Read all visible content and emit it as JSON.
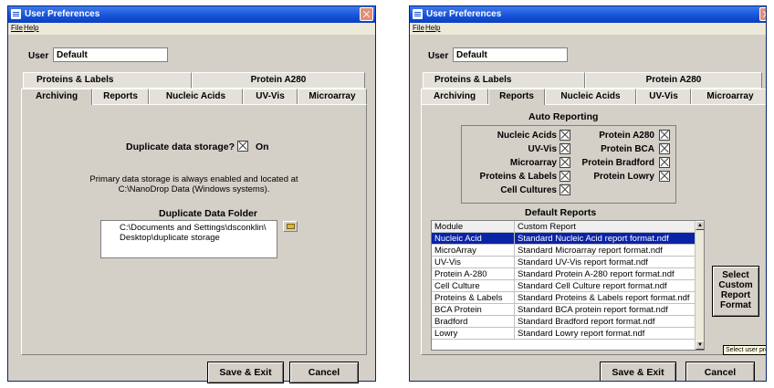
{
  "window_left": {
    "title": "User Preferences",
    "menu": {
      "file": "File",
      "help": "Help"
    },
    "user_label": "User",
    "user_value": "Default",
    "tabs_row1": [
      "Proteins & Labels",
      "Protein A280"
    ],
    "tabs_row2": [
      "Archiving",
      "Reports",
      "Nucleic Acids",
      "UV-Vis",
      "Microarray"
    ],
    "selected_tab": "Archiving",
    "duplicate_question": "Duplicate data storage?",
    "duplicate_state": "On",
    "primary_note_line1": "Primary data storage is always enabled and located at",
    "primary_note_line2": "C:\\NanoDrop Data (Windows systems).",
    "folder_heading": "Duplicate Data Folder",
    "folder_line1": "C:\\Documents and Settings\\dsconklin\\",
    "folder_line2": "Desktop\\duplicate storage",
    "save_label": "Save & Exit",
    "cancel_label": "Cancel"
  },
  "window_right": {
    "title": "User Preferences",
    "menu": {
      "file": "File",
      "help": "Help"
    },
    "user_label": "User",
    "user_value": "Default",
    "tabs_row1": [
      "Proteins & Labels",
      "Protein A280"
    ],
    "tabs_row2": [
      "Archiving",
      "Reports",
      "Nucleic Acids",
      "UV-Vis",
      "Microarray"
    ],
    "selected_tab": "Reports",
    "auto_reporting_heading": "Auto Reporting",
    "auto_left": [
      "Nucleic Acids",
      "UV-Vis",
      "Microarray",
      "Proteins & Labels"
    ],
    "auto_right": [
      "Protein A280",
      "Protein BCA",
      "Protein Bradford",
      "Protein Lowry"
    ],
    "auto_bottom": "Cell Cultures",
    "default_reports_heading": "Default Reports",
    "columns": [
      "Module",
      "Custom Report"
    ],
    "rows": [
      [
        "Nucleic Acid",
        "Standard Nucleic Acid report format.ndf"
      ],
      [
        "MicroArray",
        "Standard Microarray report format.ndf"
      ],
      [
        "UV-Vis",
        "Standard UV-Vis report format.ndf"
      ],
      [
        "Protein A-280",
        "Standard Protein A-280 report format.ndf"
      ],
      [
        "Cell Culture",
        "Standard Cell Culture report format.ndf"
      ],
      [
        "Proteins & Labels",
        "Standard Proteins & Labels report format.ndf"
      ],
      [
        "BCA Protein",
        "Standard BCA protein report format.ndf"
      ],
      [
        "Bradford",
        "Standard Bradford report format.ndf"
      ],
      [
        "Lowry",
        "Standard Lowry report format.ndf"
      ]
    ],
    "select_button": [
      "Select",
      "Custom",
      "Report",
      "Format"
    ],
    "tooltip": "Select user pre",
    "save_label": "Save & Exit",
    "cancel_label": "Cancel"
  },
  "colors": {
    "title_bar": "#1651d6",
    "selection": "#0a24a8",
    "dialog_face": "#d4d0c8"
  }
}
